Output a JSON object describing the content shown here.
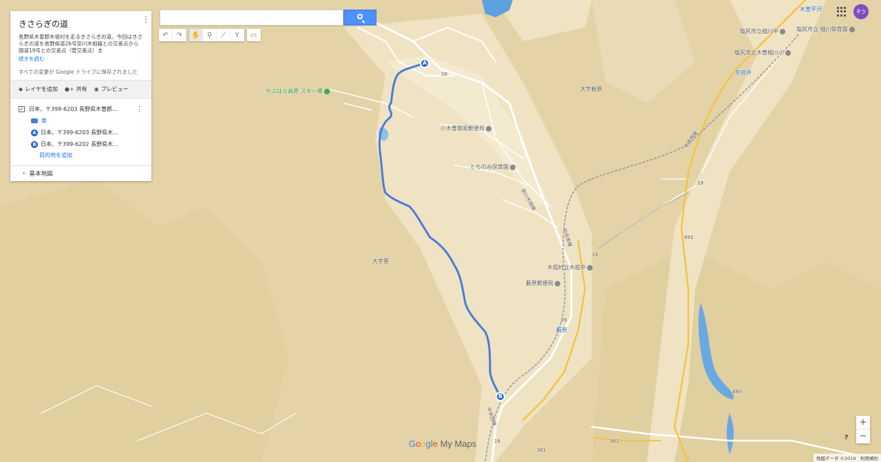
{
  "map": {
    "title": "きさらぎの道",
    "description": "長野県木曽郡木祖村を走るきさらぎの道。今回はきさらぎの道を長野県道26号奈川木祖線との交差点から国道19号との交差点（菅交差点）ま",
    "read_more": "続きを読む",
    "saved_note": "すべての変更が Google ドライブに保存されました"
  },
  "actions": {
    "add_layer": "レイヤを追加",
    "share": "共有",
    "preview": "プレビュー"
  },
  "layer": {
    "name": "日本、〒399-6203 長野県木曽郡...",
    "mode": "車",
    "point_a_letter": "A",
    "point_a": "日本、〒399-6203 長野県木...",
    "point_b_letter": "B",
    "point_b": "日本、〒399-6202 長野県木...",
    "add_destination": "目的地を追加"
  },
  "basemap": "基本地図",
  "search": {
    "value": "",
    "placeholder": ""
  },
  "user": {
    "avatar_text": "ぞう"
  },
  "zoom": {
    "in": "+",
    "out": "−"
  },
  "help": "?",
  "brand": {
    "g1": "G",
    "g2": "o",
    "g3": "o",
    "g4": "g",
    "g5": "l",
    "g6": "e",
    "rest": "My Maps"
  },
  "attribution": "地図データ ©2019　利用規約",
  "labels": {
    "ski": "やぶはら高原 スキー場",
    "post1": "小木曽簡易郵便局",
    "nursery1": "とちのみ保育園",
    "oaza1": "大字薮原",
    "oaza2": "大字菅",
    "village_office": "木祖村立木祖中",
    "post2": "藪原郵便局",
    "station1": "藪原",
    "station2": "奈良井",
    "station3": "木曽平沢",
    "school1": "塩尻市立楢川中",
    "school2": "塩尻市立木曽楢川小",
    "nursery2": "塩尻市立 楢川保育園",
    "chuo1": "中央西線",
    "chuo2": "中央本線",
    "chuo3": "中央西線",
    "road_nagawa": "奈川木祖線",
    "r26a": "26",
    "r26b": "26",
    "r19a": "19",
    "r19b": "19",
    "r19c": "19",
    "r493a": "493",
    "r493b": "493",
    "r361a": "361",
    "r361b": "361",
    "hirasawa_partial": "木曽平沢"
  },
  "markers": {
    "a": "A",
    "b": "B"
  },
  "colors": {
    "route": "#4a7cd8",
    "marker": "#1f5fd1",
    "terrain": "#e6d8b0",
    "valley": "#f2e9cc",
    "road": "#ffffff",
    "water": "#5ea0e0"
  }
}
